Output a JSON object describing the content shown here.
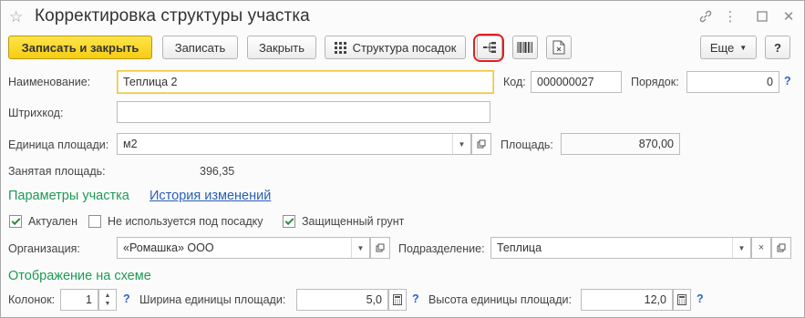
{
  "window": {
    "title": "Корректировка структуры участка"
  },
  "toolbar": {
    "save_close": "Записать и закрыть",
    "save": "Записать",
    "close": "Закрыть",
    "planting_structure": "Структура посадок",
    "more": "Еще",
    "help": "?"
  },
  "form": {
    "name_label": "Наименование:",
    "name_value": "Теплица 2",
    "code_label": "Код:",
    "code_value": "000000027",
    "order_label": "Порядок:",
    "order_value": "0",
    "barcode_label": "Штрихкод:",
    "barcode_value": "",
    "area_unit_label": "Единица площади:",
    "area_unit_value": "м2",
    "area_label": "Площадь:",
    "area_value": "870,00",
    "occupied_label": "Занятая площадь:",
    "occupied_value": "396,35"
  },
  "sections": {
    "params": "Параметры участка",
    "history": "История изменений",
    "display": "Отображение на схеме"
  },
  "checkboxes": {
    "active": {
      "label": "Актуален",
      "checked": true
    },
    "not_used": {
      "label": "Не используется под посадку",
      "checked": false
    },
    "protected": {
      "label": "Защищенный грунт",
      "checked": true
    }
  },
  "org": {
    "org_label": "Организация:",
    "org_value": "«Ромашка» ООО",
    "dept_label": "Подразделение:",
    "dept_value": "Теплица"
  },
  "display": {
    "columns_label": "Колонок:",
    "columns_value": "1",
    "unit_width_label": "Ширина единицы площади:",
    "unit_width_value": "5,0",
    "unit_height_label": "Высота единицы площади:",
    "unit_height_value": "12,0"
  },
  "help_mark": "?",
  "colors": {
    "primary_button": "#f5cd12",
    "section_green": "#1f9a56",
    "link_blue": "#2a5fb4",
    "highlight_red": "#e0201d"
  }
}
